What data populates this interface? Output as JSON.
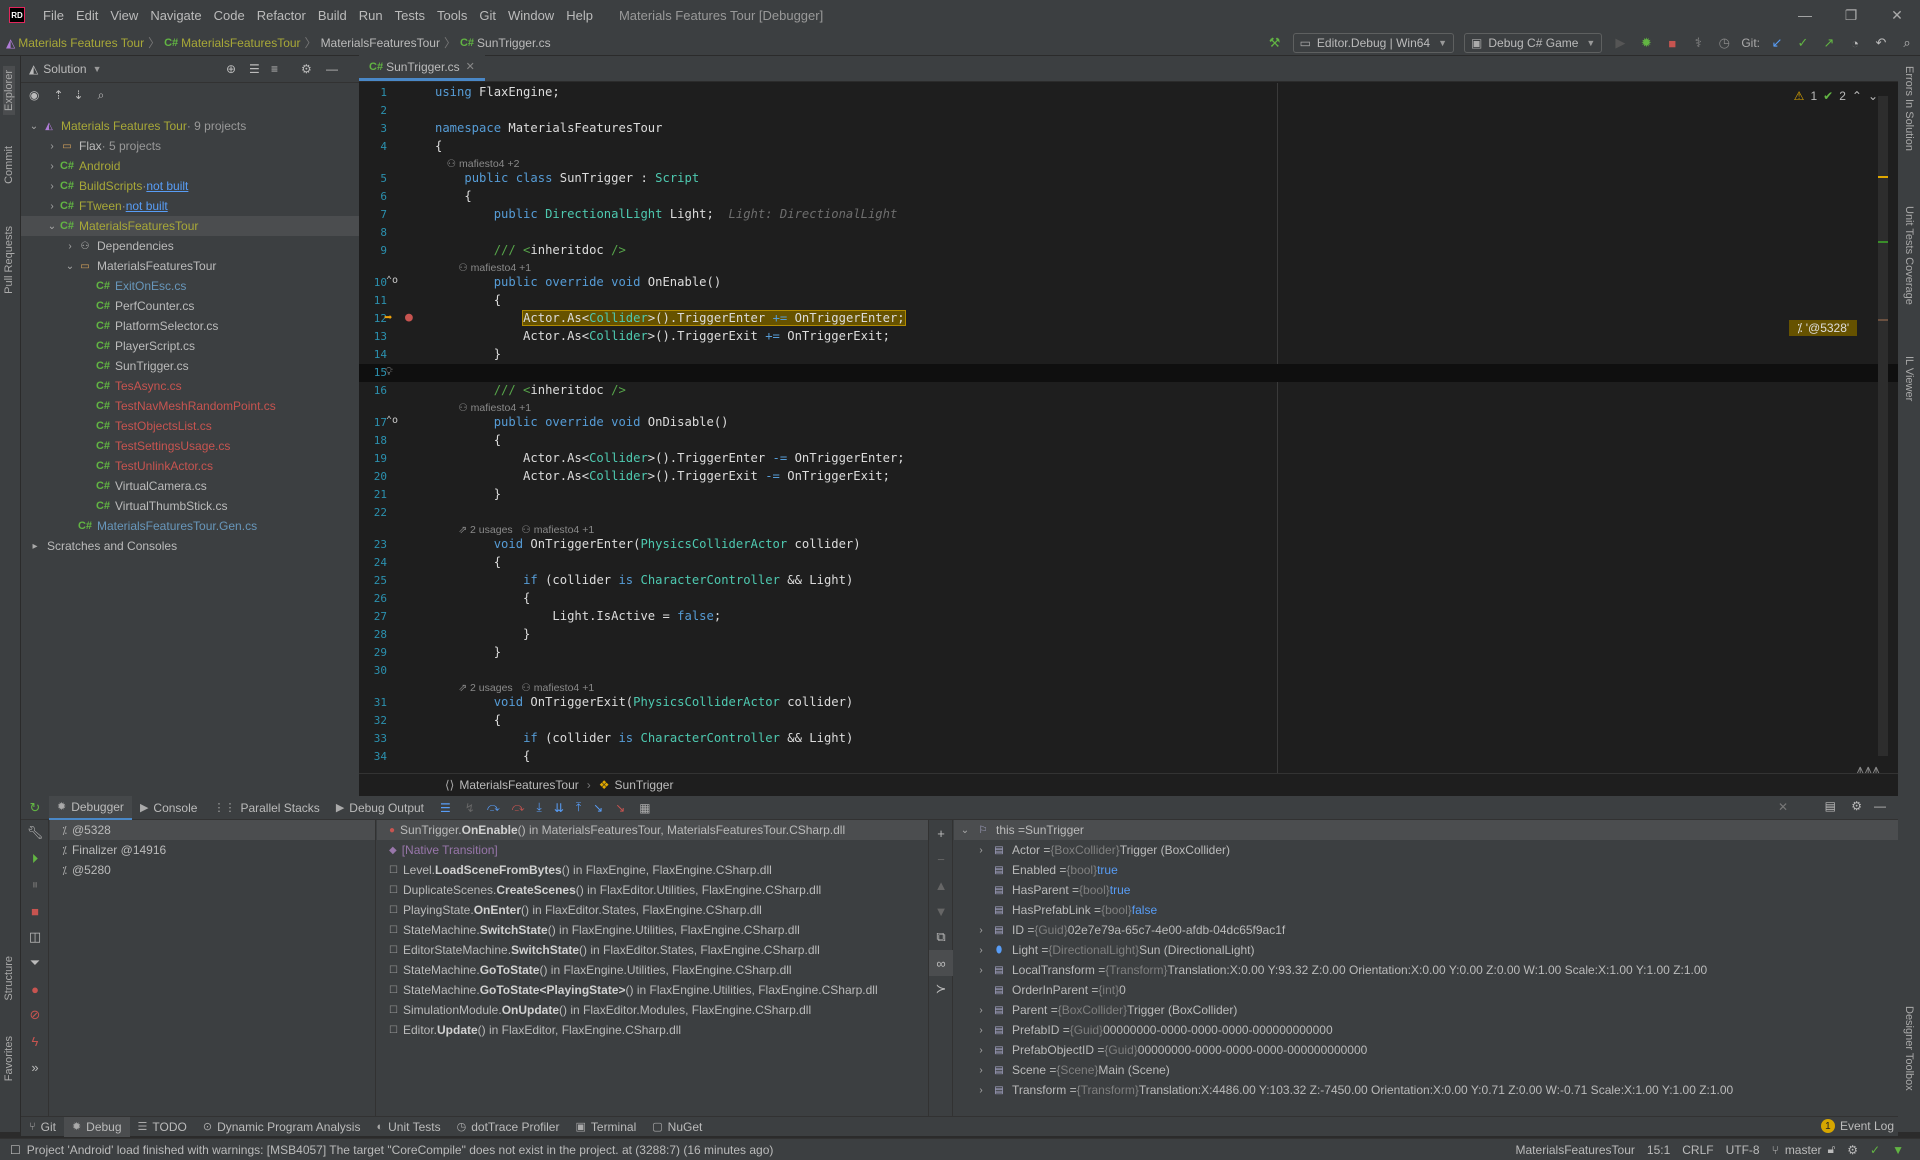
{
  "window": {
    "title": "Materials Features Tour [Debugger]",
    "logo": "RD"
  },
  "menu": [
    "File",
    "Edit",
    "View",
    "Navigate",
    "Code",
    "Refactor",
    "Build",
    "Run",
    "Tests",
    "Tools",
    "Git",
    "Window",
    "Help"
  ],
  "breadcrumb": [
    "Materials Features Tour",
    "MaterialsFeaturesTour",
    "MaterialsFeaturesTour",
    "SunTrigger.cs"
  ],
  "toolbar": {
    "config": "Editor.Debug | Win64",
    "run_config": "Debug C# Game",
    "git_label": "Git:"
  },
  "left_strip": [
    "Explorer",
    "Commit",
    "Pull Requests",
    "Structure",
    "Favorites"
  ],
  "right_strip": [
    "Errors In Solution",
    "Unit Tests Coverage",
    "IL Viewer",
    "Designer Toolbox"
  ],
  "explorer": {
    "title": "Solution",
    "tree": [
      {
        "label": "Materials Features Tour",
        "suffix": "· 9 projects",
        "level": 0,
        "expanded": true,
        "kind": "solution",
        "color": "olive"
      },
      {
        "label": "Flax",
        "suffix": "· 5 projects",
        "level": 1,
        "expanded": false,
        "kind": "folder",
        "color": "normal"
      },
      {
        "label": "Android",
        "suffix": "",
        "level": 1,
        "expanded": false,
        "kind": "project",
        "color": "olive"
      },
      {
        "label": "BuildScripts",
        "suffix": "·",
        "link": "not built",
        "level": 1,
        "expanded": false,
        "kind": "project",
        "color": "olive"
      },
      {
        "label": "FTween",
        "suffix": "·",
        "link": "not built",
        "level": 1,
        "expanded": false,
        "kind": "project",
        "color": "olive"
      },
      {
        "label": "MaterialsFeaturesTour",
        "suffix": "",
        "level": 1,
        "expanded": true,
        "kind": "project",
        "color": "olive",
        "selected": true
      },
      {
        "label": "Dependencies",
        "suffix": "",
        "level": 2,
        "expanded": false,
        "kind": "deps",
        "color": "normal"
      },
      {
        "label": "MaterialsFeaturesTour",
        "suffix": "",
        "level": 2,
        "expanded": true,
        "kind": "folder",
        "color": "normal"
      },
      {
        "label": "ExitOnEsc.cs",
        "level": 3,
        "kind": "file",
        "color": "blue"
      },
      {
        "label": "PerfCounter.cs",
        "level": 3,
        "kind": "file",
        "color": "normal"
      },
      {
        "label": "PlatformSelector.cs",
        "level": 3,
        "kind": "file",
        "color": "normal"
      },
      {
        "label": "PlayerScript.cs",
        "level": 3,
        "kind": "file",
        "color": "normal"
      },
      {
        "label": "SunTrigger.cs",
        "level": 3,
        "kind": "file",
        "color": "normal"
      },
      {
        "label": "TesAsync.cs",
        "level": 3,
        "kind": "file",
        "color": "red"
      },
      {
        "label": "TestNavMeshRandomPoint.cs",
        "level": 3,
        "kind": "file",
        "color": "red"
      },
      {
        "label": "TestObjectsList.cs",
        "level": 3,
        "kind": "file",
        "color": "red"
      },
      {
        "label": "TestSettingsUsage.cs",
        "level": 3,
        "kind": "file",
        "color": "red"
      },
      {
        "label": "TestUnlinkActor.cs",
        "level": 3,
        "kind": "file",
        "color": "red"
      },
      {
        "label": "VirtualCamera.cs",
        "level": 3,
        "kind": "file",
        "color": "normal"
      },
      {
        "label": "VirtualThumbStick.cs",
        "level": 3,
        "kind": "file",
        "color": "normal"
      },
      {
        "label": "MaterialsFeaturesTour.Gen.cs",
        "level": 2,
        "kind": "file",
        "color": "blue"
      },
      {
        "label": "Scratches and Consoles",
        "level": 0,
        "kind": "scratch",
        "color": "normal"
      }
    ]
  },
  "editor": {
    "tab": "SunTrigger.cs",
    "inspections": {
      "warnings": "1",
      "ok": "2"
    },
    "exec_tag": "'@5328'",
    "breadcrumb": [
      "MaterialsFeaturesTour",
      "SunTrigger"
    ],
    "lines": [
      {
        "n": "1",
        "html": "<span class='kw'>using</span> FlaxEngine;"
      },
      {
        "n": "2",
        "html": ""
      },
      {
        "n": "3",
        "html": "<span class='kw'>namespace</span> MaterialsFeaturesTour"
      },
      {
        "n": "4",
        "html": "{"
      },
      {
        "lens": "    ⚇ mafiesto4 +2"
      },
      {
        "n": "5",
        "html": "    <span class='kw'>public class</span> SunTrigger : <span class='ty'>Script</span>"
      },
      {
        "n": "6",
        "html": "    {"
      },
      {
        "n": "7",
        "html": "        <span class='kw'>public</span> <span class='ty'>DirectionalLight</span> Light;  <span class='hint'>Light: DirectionalLight</span>"
      },
      {
        "n": "8",
        "html": ""
      },
      {
        "n": "9",
        "html": "        <span class='cm'>/// &lt;</span>inheritdoc <span class='cm'>/&gt;</span>"
      },
      {
        "lens": "        ⚇ mafiesto4 +1"
      },
      {
        "n": "10",
        "html": "        <span class='kw'>public override void</span> OnEnable()"
      },
      {
        "n": "11",
        "html": "        {"
      },
      {
        "n": "12",
        "html": "            <span class='exec'>Actor.As&lt;<span class='ty'>Collider</span>&gt;().TriggerEnter <span class='kw'>+=</span> OnTriggerEnter;</span>",
        "exec": true
      },
      {
        "n": "13",
        "html": "            Actor.As&lt;<span class='ty'>Collider</span>&gt;().TriggerExit <span class='kw'>+=</span> OnTriggerExit;"
      },
      {
        "n": "14",
        "html": "        }"
      },
      {
        "n": "15",
        "html": "",
        "current": true
      },
      {
        "n": "16",
        "html": "        <span class='cm'>/// &lt;</span>inheritdoc <span class='cm'>/&gt;</span>"
      },
      {
        "lens": "        ⚇ mafiesto4 +1"
      },
      {
        "n": "17",
        "html": "        <span class='kw'>public override void</span> OnDisable()"
      },
      {
        "n": "18",
        "html": "        {"
      },
      {
        "n": "19",
        "html": "            Actor.As&lt;<span class='ty'>Collider</span>&gt;().TriggerEnter <span class='kw'>-=</span> OnTriggerEnter;"
      },
      {
        "n": "20",
        "html": "            Actor.As&lt;<span class='ty'>Collider</span>&gt;().TriggerExit <span class='kw'>-=</span> OnTriggerExit;"
      },
      {
        "n": "21",
        "html": "        }"
      },
      {
        "n": "22",
        "html": ""
      },
      {
        "lens": "        ⇗ 2 usages   ⚇ mafiesto4 +1"
      },
      {
        "n": "23",
        "html": "        <span class='kw'>void</span> OnTriggerEnter(<span class='ty'>PhysicsColliderActor</span> collider)"
      },
      {
        "n": "24",
        "html": "        {"
      },
      {
        "n": "25",
        "html": "            <span class='kw'>if</span> (collider <span class='kw'>is</span> <span class='ty'>CharacterController</span> && Light)"
      },
      {
        "n": "26",
        "html": "            {"
      },
      {
        "n": "27",
        "html": "                Light.IsActive = <span class='kw'>false</span>;"
      },
      {
        "n": "28",
        "html": "            }"
      },
      {
        "n": "29",
        "html": "        }"
      },
      {
        "n": "30",
        "html": ""
      },
      {
        "lens": "        ⇗ 2 usages   ⚇ mafiesto4 +1"
      },
      {
        "n": "31",
        "html": "        <span class='kw'>void</span> OnTriggerExit(<span class='ty'>PhysicsColliderActor</span> collider)"
      },
      {
        "n": "32",
        "html": "        {"
      },
      {
        "n": "33",
        "html": "            <span class='kw'>if</span> (collider <span class='kw'>is</span> <span class='ty'>CharacterController</span> && Light)"
      },
      {
        "n": "34",
        "html": "            {"
      }
    ]
  },
  "debugger": {
    "tabs": [
      "Debugger",
      "Console",
      "Parallel Stacks",
      "Debug Output"
    ],
    "threads": [
      "@5328",
      "Finalizer @14916",
      "@5280"
    ],
    "frames": [
      {
        "cls": "SunTrigger.",
        "fn": "OnEnable",
        "rest": "() in MaterialsFeaturesTour, MaterialsFeaturesTour.CSharp.dll",
        "marker": "dot",
        "selected": true
      },
      {
        "native": "[Native Transition]",
        "marker": "diamond"
      },
      {
        "cls": "Level.",
        "fn": "LoadSceneFromBytes",
        "rest": "() in FlaxEngine, FlaxEngine.CSharp.dll"
      },
      {
        "cls": "DuplicateScenes.",
        "fn": "CreateScenes",
        "rest": "() in FlaxEditor.Utilities, FlaxEngine.CSharp.dll"
      },
      {
        "cls": "PlayingState.",
        "fn": "OnEnter",
        "rest": "() in FlaxEditor.States, FlaxEngine.CSharp.dll"
      },
      {
        "cls": "StateMachine.",
        "fn": "SwitchState",
        "rest": "() in FlaxEngine.Utilities, FlaxEngine.CSharp.dll"
      },
      {
        "cls": "EditorStateMachine.",
        "fn": "SwitchState",
        "rest": "() in FlaxEditor.States, FlaxEngine.CSharp.dll"
      },
      {
        "cls": "StateMachine.",
        "fn": "GoToState",
        "rest": "() in FlaxEngine.Utilities, FlaxEngine.CSharp.dll"
      },
      {
        "cls": "StateMachine.",
        "fn": "GoToState<PlayingState>",
        "rest": "() in FlaxEngine.Utilities, FlaxEngine.CSharp.dll"
      },
      {
        "cls": "SimulationModule.",
        "fn": "OnUpdate",
        "rest": "() in FlaxEditor.Modules, FlaxEngine.CSharp.dll"
      },
      {
        "cls": "Editor.",
        "fn": "Update",
        "rest": "() in FlaxEditor, FlaxEngine.CSharp.dll"
      }
    ],
    "variables": [
      {
        "name": "this",
        "type": "",
        "value": "SunTrigger",
        "level": 0,
        "expanded": true,
        "selected": true
      },
      {
        "name": "Actor",
        "type": "{BoxCollider}",
        "value": "Trigger (BoxCollider)",
        "level": 1,
        "expandable": true
      },
      {
        "name": "Enabled",
        "type": "{bool}",
        "value": "true",
        "kw": true,
        "level": 1
      },
      {
        "name": "HasParent",
        "type": "{bool}",
        "value": "true",
        "kw": true,
        "level": 1
      },
      {
        "name": "HasPrefabLink",
        "type": "{bool}",
        "value": "false",
        "kw": true,
        "level": 1
      },
      {
        "name": "ID",
        "type": "{Guid}",
        "value": "02e7e79a-65c7-4e00-afdb-04dc65f9ac1f",
        "level": 1,
        "expandable": true
      },
      {
        "name": "Light",
        "type": "{DirectionalLight}",
        "value": "Sun (DirectionalLight)",
        "level": 1,
        "expandable": true
      },
      {
        "name": "LocalTransform",
        "type": "{Transform}",
        "value": "Translation:X:0.00 Y:93.32 Z:0.00 Orientation:X:0.00 Y:0.00 Z:0.00 W:1.00 Scale:X:1.00 Y:1.00 Z:1.00",
        "level": 1,
        "expandable": true
      },
      {
        "name": "OrderInParent",
        "type": "{int}",
        "value": "0",
        "level": 1
      },
      {
        "name": "Parent",
        "type": "{BoxCollider}",
        "value": "Trigger (BoxCollider)",
        "level": 1,
        "expandable": true
      },
      {
        "name": "PrefabID",
        "type": "{Guid}",
        "value": "00000000-0000-0000-0000-000000000000",
        "level": 1,
        "expandable": true
      },
      {
        "name": "PrefabObjectID",
        "type": "{Guid}",
        "value": "00000000-0000-0000-0000-000000000000",
        "level": 1,
        "expandable": true
      },
      {
        "name": "Scene",
        "type": "{Scene}",
        "value": "Main (Scene)",
        "level": 1,
        "expandable": true
      },
      {
        "name": "Transform",
        "type": "{Transform}",
        "value": "Translation:X:4486.00 Y:103.32 Z:-7450.00 Orientation:X:0.00 Y:0.71 Z:0.00 W:-0.71 Scale:X:1.00 Y:1.00 Z:1.00",
        "level": 1,
        "expandable": true
      }
    ]
  },
  "bottom_tabs": [
    "Git",
    "Debug",
    "TODO",
    "Dynamic Program Analysis",
    "Unit Tests",
    "dotTrace Profiler",
    "Terminal",
    "NuGet"
  ],
  "event_log": {
    "count": "1",
    "label": "Event Log"
  },
  "status": {
    "message": "Project 'Android' load finished with warnings: [MSB4057] The target \"CoreCompile\" does not exist in the project. at (3288:7) (16 minutes ago)",
    "project": "MaterialsFeaturesTour",
    "position": "15:1",
    "line_ending": "CRLF",
    "encoding": "UTF-8",
    "branch": "master"
  },
  "colors": {
    "accent": "#4a88c7",
    "olive": "#a8a838",
    "exec_bg": "#665200",
    "error_red": "#c75450"
  }
}
